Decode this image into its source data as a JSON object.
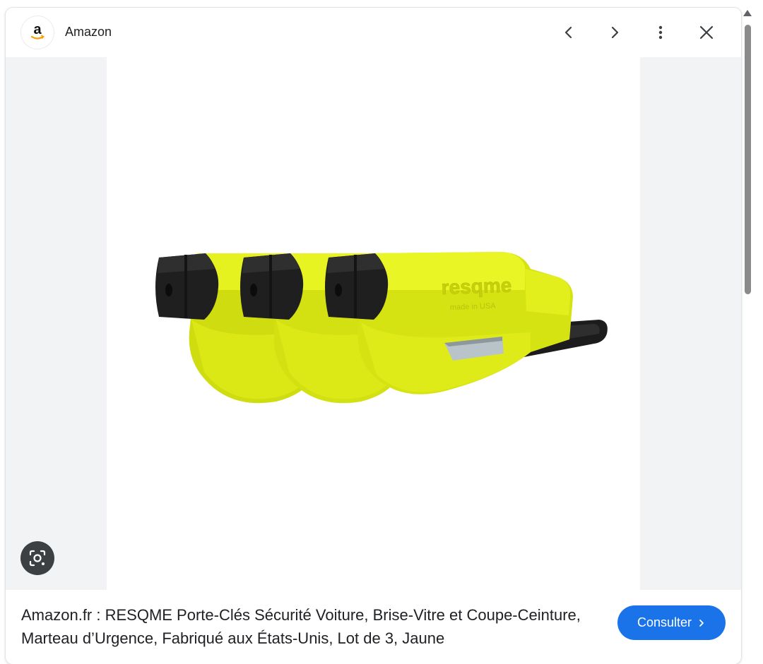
{
  "header": {
    "source_name": "Amazon",
    "logo_letter": "a",
    "icons": {
      "prev": "chevron-left-icon",
      "next": "chevron-right-icon",
      "more": "more-vert-icon",
      "close": "close-icon"
    }
  },
  "product_image": {
    "brand_mark": "resqme",
    "brand_sub": "made in USA",
    "color": "#e2ee15"
  },
  "lens": {
    "icon": "lens-search-icon"
  },
  "caption": {
    "text": "Amazon.fr : RESQME Porte-Clés Sécurité Voiture, Brise-Vitre et Coupe-Ceinture, Marteau d’Urgence, Fabriqué aux États-Unis, Lot de 3, Jaune"
  },
  "action": {
    "label": "Consulter",
    "color": "#1a73e8"
  }
}
